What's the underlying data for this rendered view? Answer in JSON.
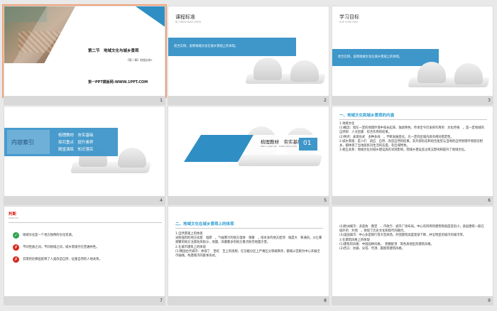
{
  "slides": [
    {
      "n": "1",
      "title": "第二节　地域文化与城乡景观",
      "subtitle": "【第二章】地理必修2",
      "site": "第一PPT模板网-WWW.1PPT.COM"
    },
    {
      "n": "2",
      "heading": "课程标准",
      "heading_en": "BI CHENG BIAO ZHUN",
      "body": "结合实例，说明地域文化在城乡景观上的体现。"
    },
    {
      "n": "3",
      "heading": "学习目标",
      "heading_en": "XUE XI MU BIAO",
      "body": "结合实例，说明地域文化在城乡景观上的体现。"
    },
    {
      "n": "4",
      "box_title": "内容索引",
      "items": [
        "梳理教材　夯实基础",
        "探究重点　提升素养",
        "随堂演练　知识落实"
      ]
    },
    {
      "n": "5",
      "title": "梳理教材　夯实基础",
      "title_en": "SHU LI JIAO CAI　HANG SHI JI CHU",
      "index": "01"
    },
    {
      "n": "6",
      "heading": "一、地域文化和城乡景观的内涵",
      "lines": [
        "1.地域文化",
        "(1)概念：指在一定的地理环境中或长起来、独具特色、传承至今仍发挥作用的　文化传统　，是一定地域的自然和　人文因素　综合作用的结果。",
        "(2)特点：表现形式　多种多样　，不断发展变化，在一定的区域内具有相对稳定性。",
        "2.城乡景观：是人们　适应　自然、改造自然的结果，其外部形态和组合类型与当地的自然地理环境密切相关，都体现了当地居民对生活的态度，有区域特色。",
        "3.相互关系：地域文化对城乡建设具有深刻影响，而城乡建设反过来又影响和提升了地域文化。"
      ]
    },
    {
      "n": "7",
      "badge": "判断",
      "badge_en": "PANDUAN",
      "items": [
        {
          "mark": "✓",
          "ok": true,
          "text": "地域文化是一个地方独特的文化资源。"
        },
        {
          "mark": "✗",
          "ok": false,
          "text": "不同性质之间，不同地域之间，城乡景观存在普遍共性。"
        },
        {
          "mark": "✗",
          "ok": false,
          "text": "云南哈尼梯田反映了人类改造自然、征服自然的人地关系。"
        }
      ]
    },
    {
      "n": "8",
      "heading": "二、地域文化在城乡景观上的体现",
      "lines": [
        "1.自然景观上的体现",
        "光照强烈的地方房屋　墙厚　，气候寒冷的地方墙体　保暖　，雨水多的地方屋顶　坡度大　和通风，沙尘暴频繁的地方注意防风防沙，地震、风暴都多的地方重点防范地震灾害。",
        "2.在城市建筑上的体现",
        "(1)我国古代城市：体现了　皇权　至上的思想，在功能分区上严格区分等级秩序，都城以宫殿为中心开展全市轴线，构建城市的基本形式。"
      ]
    },
    {
      "n": "9",
      "lines": [
        "(2)欧洲城市：多是依　教堂　、市政厅、城市广场布局，中心有四周的建筑物高度差别小，高层建筑一般在城外的　外围　，体现了历史文化和现代的融合。",
        "(3)美国城市：中心多是银行等大型商场，外围建筑高度逐渐下降，并呈明显的城市的城市带。",
        "3.在建筑风格上的体现",
        "(1)建筑的风格：中国园林风格，　卷棚屋顶　等各具地区的建筑风格。",
        "(2)西方：柱廊、尖塔、穹顶、圆窗等建筑风格。"
      ]
    }
  ],
  "colors": {
    "accent": "#2c9bd2",
    "red": "#d9261c",
    "green": "#31a24c"
  }
}
